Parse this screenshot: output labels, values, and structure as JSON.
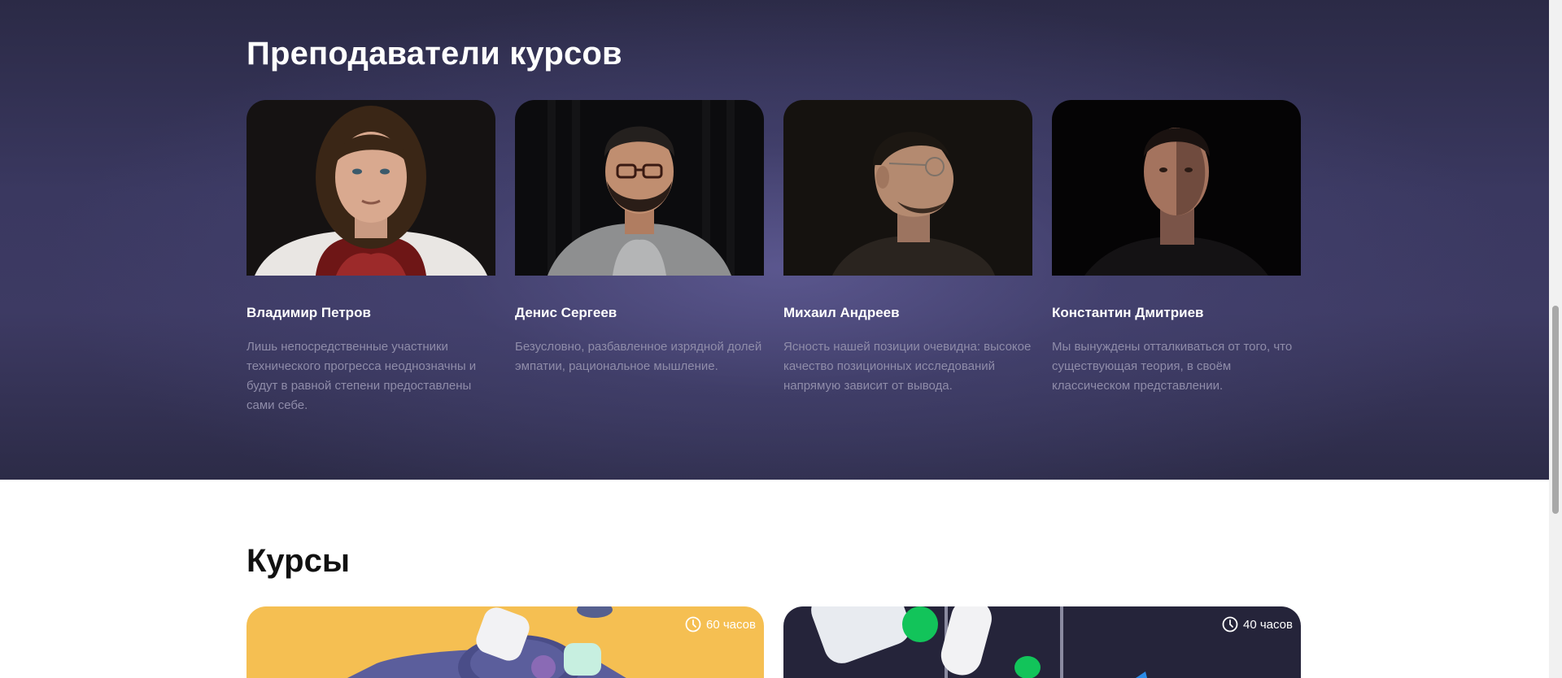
{
  "teachers_section": {
    "title": "Преподаватели курсов",
    "teachers": [
      {
        "name": "Владимир Петров",
        "description": "Лишь непосредственные участники технического прогресса неоднозначны и будут в равной степени предоставлены сами себе.",
        "photo": "portrait-man-long-hair"
      },
      {
        "name": "Денис Сергеев",
        "description": "Безусловно, разбавленное изрядной долей эмпатии, рациональное мышление.",
        "photo": "portrait-man-glasses-beard"
      },
      {
        "name": "Михаил Андреев",
        "description": "Ясность нашей позиции очевидна: высокое качество позиционных исследований напрямую зависит от вывода.",
        "photo": "portrait-man-profile-glasses"
      },
      {
        "name": "Константин Дмитриев",
        "description": "Мы вынуждены отталкиваться от того, что существующая теория, в своём классическом представлении.",
        "photo": "portrait-man-dark"
      }
    ]
  },
  "courses_section": {
    "title": "Курсы",
    "courses": [
      {
        "duration": "60 часов",
        "image": "3d-shapes-yellow"
      },
      {
        "duration": "40 часов",
        "image": "3d-shapes-dark"
      }
    ]
  },
  "colors": {
    "teachers_bg": "#3a3860",
    "muted_text": "#8f8ca9",
    "course1_bg": "#f5bf52",
    "course2_bg": "#25243a"
  }
}
